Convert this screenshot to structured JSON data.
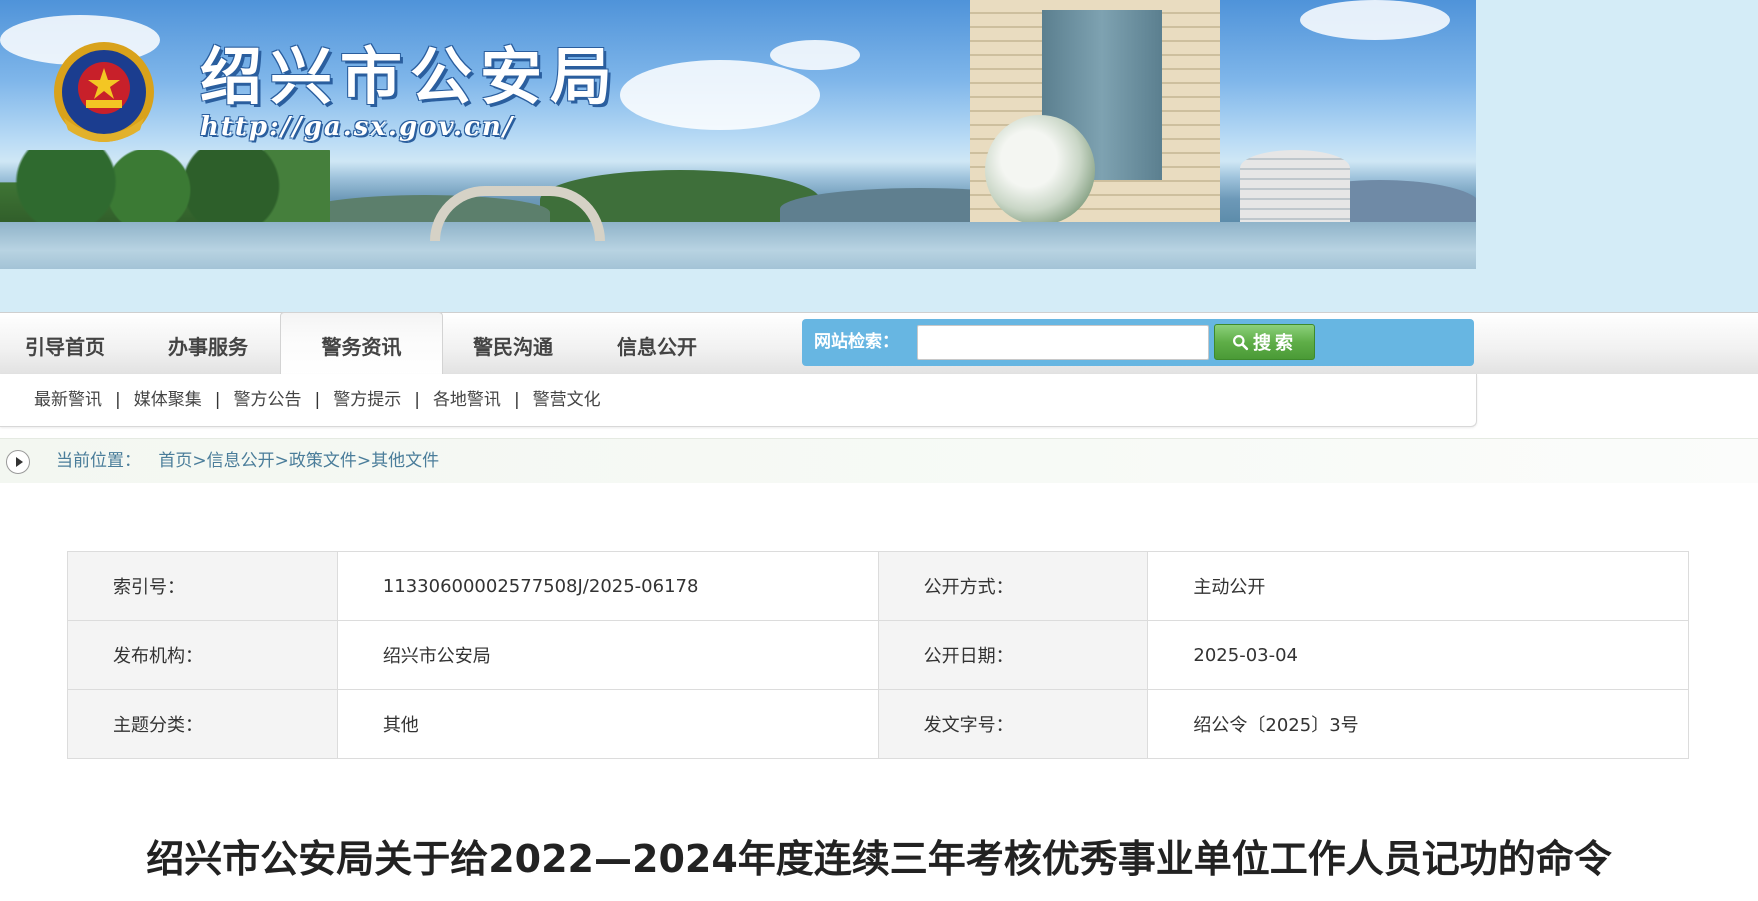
{
  "header": {
    "site_title": "绍兴市公安局",
    "site_url": "http://ga.sx.gov.cn/",
    "emblem_icon": "police-emblem-icon"
  },
  "nav": {
    "items": [
      {
        "label": "引导首页"
      },
      {
        "label": "办事服务"
      },
      {
        "label": "警务资讯"
      },
      {
        "label": "警民沟通"
      },
      {
        "label": "信息公开"
      }
    ],
    "active_index": 2
  },
  "search": {
    "label": "网站检索：",
    "input_value": "",
    "button_label": "搜索",
    "button_icon": "magnifier-icon"
  },
  "subnav": {
    "items": [
      "最新警讯",
      "媒体聚集",
      "警方公告",
      "警方提示",
      "各地警讯",
      "警营文化"
    ],
    "separator": "|"
  },
  "breadcrumb": {
    "prefix": "当前位置：",
    "items": [
      "首页",
      "信息公开",
      "政策文件",
      "其他文件"
    ],
    "separator": ">"
  },
  "info_table": {
    "rows": [
      {
        "k1": "索引号：",
        "v1": "11330600002577508J/2025-06178",
        "k2": "公开方式：",
        "v2": "主动公开"
      },
      {
        "k1": "发布机构：",
        "v1": "绍兴市公安局",
        "k2": "公开日期：",
        "v2": "2025-03-04"
      },
      {
        "k1": "主题分类：",
        "v1": "其他",
        "k2": "发文字号：",
        "v2": "绍公令〔2025〕3号"
      }
    ]
  },
  "article": {
    "title": "绍兴市公安局关于给2022—2024年度连续三年考核优秀事业单位工作人员记功的命令"
  },
  "colors": {
    "nav_search_bg": "#67b6e2",
    "search_button": "#5fae48",
    "breadcrumb_text": "#4a7d9a",
    "table_key_bg": "#f4f4f4"
  }
}
